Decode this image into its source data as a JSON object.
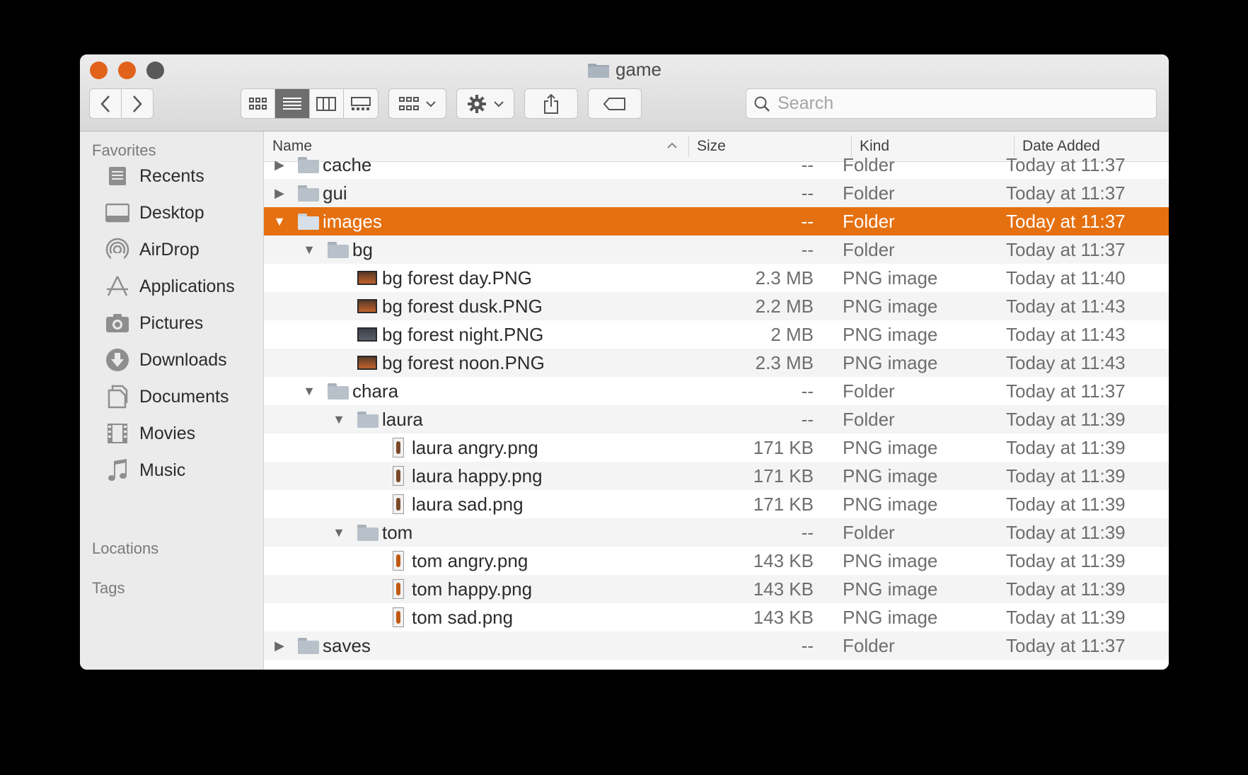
{
  "window": {
    "title": "game"
  },
  "toolbar": {
    "back_icon": "chevron-left",
    "forward_icon": "chevron-right",
    "view_modes": [
      "icon-view",
      "list-view",
      "column-view",
      "gallery-view"
    ],
    "active_view": "list-view",
    "group_icon": "group-by",
    "action_icon": "gear",
    "share_icon": "share",
    "tag_icon": "tag"
  },
  "search": {
    "placeholder": "Search",
    "value": ""
  },
  "sidebar": {
    "favorites_label": "Favorites",
    "items": [
      {
        "label": "Recents",
        "icon": "recents-icon"
      },
      {
        "label": "Desktop",
        "icon": "desktop-icon"
      },
      {
        "label": "AirDrop",
        "icon": "airdrop-icon"
      },
      {
        "label": "Applications",
        "icon": "applications-icon"
      },
      {
        "label": "Pictures",
        "icon": "pictures-icon"
      },
      {
        "label": "Downloads",
        "icon": "downloads-icon"
      },
      {
        "label": "Documents",
        "icon": "documents-icon"
      },
      {
        "label": "Movies",
        "icon": "movies-icon"
      },
      {
        "label": "Music",
        "icon": "music-icon"
      }
    ],
    "locations_label": "Locations",
    "tags_label": "Tags"
  },
  "columns": {
    "name": "Name",
    "size": "Size",
    "kind": "Kind",
    "date": "Date Added"
  },
  "files": [
    {
      "name": "cache",
      "size": "--",
      "kind": "Folder",
      "date": "Today at 11:37",
      "type": "folder",
      "level": 0,
      "disclosure": "collapsed"
    },
    {
      "name": "gui",
      "size": "--",
      "kind": "Folder",
      "date": "Today at 11:37",
      "type": "folder",
      "level": 0,
      "disclosure": "collapsed"
    },
    {
      "name": "images",
      "size": "--",
      "kind": "Folder",
      "date": "Today at 11:37",
      "type": "folder",
      "level": 0,
      "disclosure": "expanded",
      "selected": true
    },
    {
      "name": "bg",
      "size": "--",
      "kind": "Folder",
      "date": "Today at 11:37",
      "type": "folder",
      "level": 1,
      "disclosure": "expanded"
    },
    {
      "name": "bg forest day.PNG",
      "size": "2.3 MB",
      "kind": "PNG image",
      "date": "Today at 11:40",
      "type": "png",
      "level": 2
    },
    {
      "name": "bg forest dusk.PNG",
      "size": "2.2 MB",
      "kind": "PNG image",
      "date": "Today at 11:43",
      "type": "png",
      "level": 2
    },
    {
      "name": "bg forest night.PNG",
      "size": "2 MB",
      "kind": "PNG image",
      "date": "Today at 11:43",
      "type": "png-night",
      "level": 2
    },
    {
      "name": "bg forest noon.PNG",
      "size": "2.3 MB",
      "kind": "PNG image",
      "date": "Today at 11:43",
      "type": "png",
      "level": 2
    },
    {
      "name": "chara",
      "size": "--",
      "kind": "Folder",
      "date": "Today at 11:37",
      "type": "folder",
      "level": 1,
      "disclosure": "expanded"
    },
    {
      "name": "laura",
      "size": "--",
      "kind": "Folder",
      "date": "Today at 11:39",
      "type": "folder",
      "level": 2,
      "disclosure": "expanded"
    },
    {
      "name": "laura angry.png",
      "size": "171 KB",
      "kind": "PNG image",
      "date": "Today at 11:39",
      "type": "char",
      "level": 3
    },
    {
      "name": "laura happy.png",
      "size": "171 KB",
      "kind": "PNG image",
      "date": "Today at 11:39",
      "type": "char",
      "level": 3
    },
    {
      "name": "laura sad.png",
      "size": "171 KB",
      "kind": "PNG image",
      "date": "Today at 11:39",
      "type": "char",
      "level": 3
    },
    {
      "name": "tom",
      "size": "--",
      "kind": "Folder",
      "date": "Today at 11:39",
      "type": "folder",
      "level": 2,
      "disclosure": "expanded"
    },
    {
      "name": "tom angry.png",
      "size": "143 KB",
      "kind": "PNG image",
      "date": "Today at 11:39",
      "type": "char-tom",
      "level": 3
    },
    {
      "name": "tom happy.png",
      "size": "143 KB",
      "kind": "PNG image",
      "date": "Today at 11:39",
      "type": "char-tom",
      "level": 3
    },
    {
      "name": "tom sad.png",
      "size": "143 KB",
      "kind": "PNG image",
      "date": "Today at 11:39",
      "type": "char-tom",
      "level": 3
    },
    {
      "name": "saves",
      "size": "--",
      "kind": "Folder",
      "date": "Today at 11:37",
      "type": "folder",
      "level": 0,
      "disclosure": "collapsed"
    }
  ],
  "colors": {
    "selection": "#e5700f",
    "close": "#e2621b",
    "minimize": "#e2621b",
    "zoom": "#595959"
  }
}
